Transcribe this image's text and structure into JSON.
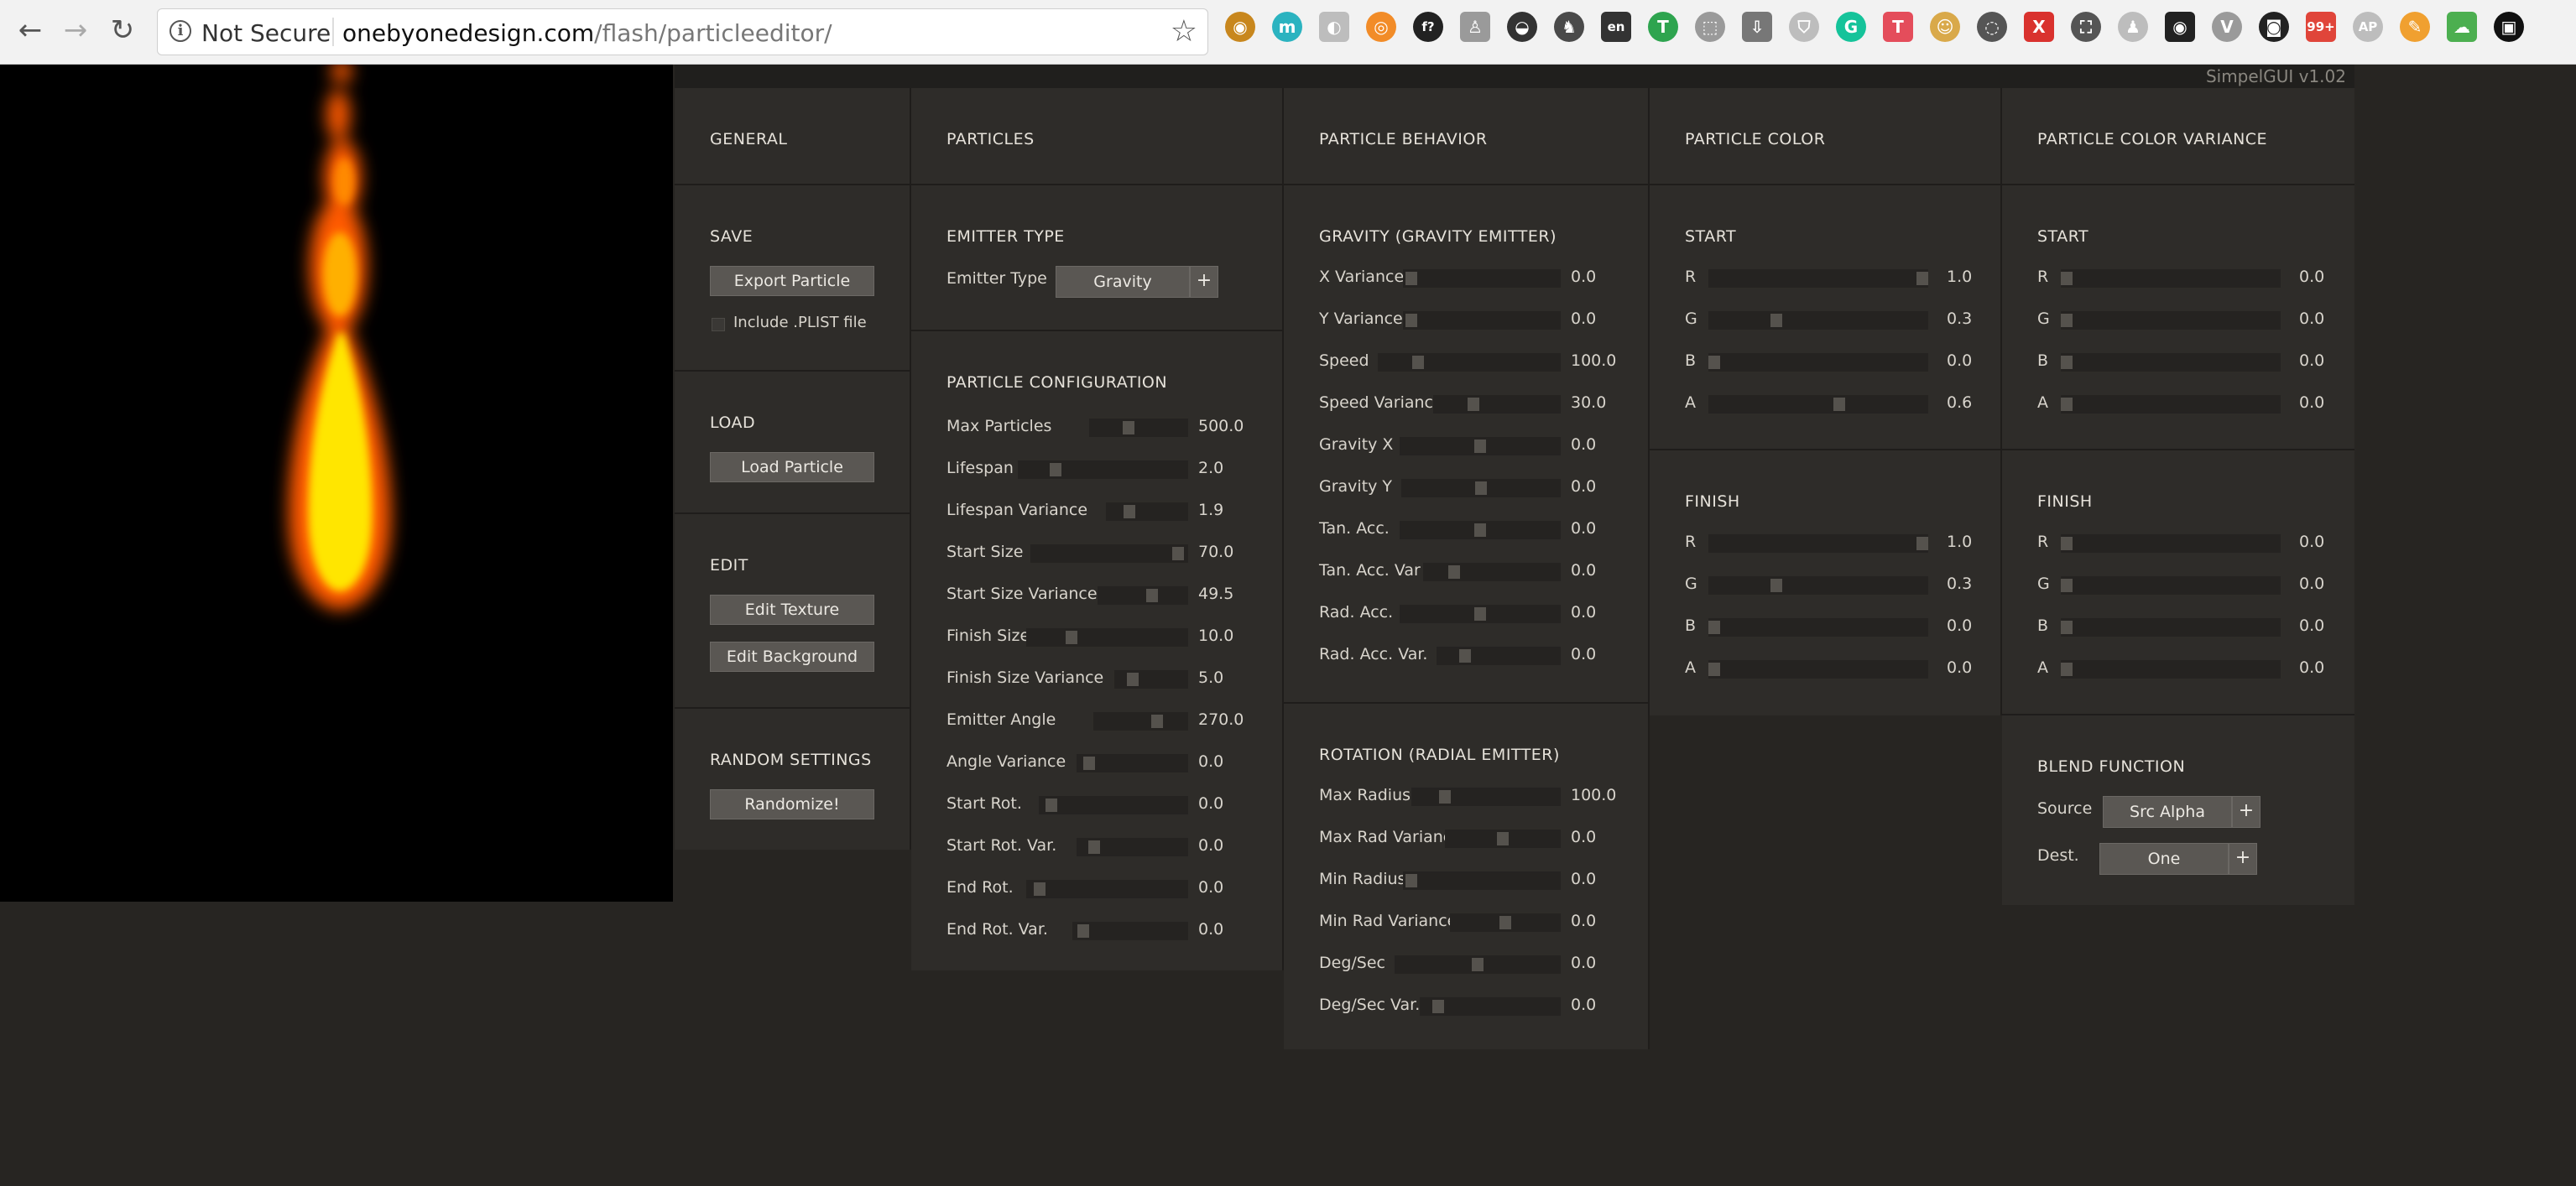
{
  "browser": {
    "back_icon": "arrow-left-icon",
    "forward_icon": "arrow-right-icon",
    "reload_icon": "reload-icon",
    "security_label": "Not Secure",
    "url_domain": "onebyonedesign.com",
    "url_path": "/flash/particleeditor/",
    "star_icon": "star-icon",
    "extensions": [
      {
        "name": "camera-ext-icon",
        "glyph": "◉",
        "color": "#c8871e"
      },
      {
        "name": "m-ext-icon",
        "glyph": "m",
        "color": "#2bb3c0"
      },
      {
        "name": "feather-ext-icon",
        "glyph": "◐",
        "color": "#bdbdbd"
      },
      {
        "name": "target-ext-icon",
        "glyph": "◎",
        "color": "#f28c28"
      },
      {
        "name": "fx-ext-icon",
        "glyph": "f?",
        "color": "#222222"
      },
      {
        "name": "person-ext-icon",
        "glyph": "♙",
        "color": "#9a9a9a"
      },
      {
        "name": "mask-ext-icon",
        "glyph": "◒",
        "color": "#333333"
      },
      {
        "name": "elephant-ext-icon",
        "glyph": "♞",
        "color": "#4a4a4a"
      },
      {
        "name": "en-ext-icon",
        "glyph": "en",
        "color": "#333333"
      },
      {
        "name": "shield-t-ext-icon",
        "glyph": "T",
        "color": "#2ea44f"
      },
      {
        "name": "puzzle-ext-icon",
        "glyph": "⬚",
        "color": "#9a9a9a"
      },
      {
        "name": "download-ext-icon",
        "glyph": "⇩",
        "color": "#777777"
      },
      {
        "name": "shield-ext-icon",
        "glyph": "⛉",
        "color": "#bdbdbd"
      },
      {
        "name": "grammarly-ext-icon",
        "glyph": "G",
        "color": "#15c39a"
      },
      {
        "name": "t-red-ext-icon",
        "glyph": "T",
        "color": "#e44d5b"
      },
      {
        "name": "face-ext-icon",
        "glyph": "☺",
        "color": "#d9a94a"
      },
      {
        "name": "ring-ext-icon",
        "glyph": "◌",
        "color": "#555555"
      },
      {
        "name": "x-ext-icon",
        "glyph": "X",
        "color": "#d9322e"
      },
      {
        "name": "frame-ext-icon",
        "glyph": "⛶",
        "color": "#555555"
      },
      {
        "name": "user-ext-icon",
        "glyph": "♟",
        "color": "#bdbdbd"
      },
      {
        "name": "eye-ext-icon",
        "glyph": "◉",
        "color": "#222222"
      },
      {
        "name": "v-ext-icon",
        "glyph": "V",
        "color": "#9a9a9a"
      },
      {
        "name": "glasses-ext-icon",
        "glyph": "◙",
        "color": "#222222"
      },
      {
        "name": "gift-ext-icon",
        "glyph": "99+",
        "color": "#e0453a"
      },
      {
        "name": "ap-ext-icon",
        "glyph": "AP",
        "color": "#bdbdbd"
      },
      {
        "name": "pencil-ext-icon",
        "glyph": "✎",
        "color": "#f0a030"
      },
      {
        "name": "cloud-ext-icon",
        "glyph": "☁",
        "color": "#4caf50"
      },
      {
        "name": "square-ext-icon",
        "glyph": "▣",
        "color": "#111111"
      }
    ]
  },
  "header": {
    "version": "SimpelGUI v1.02"
  },
  "general": {
    "heading": "GENERAL",
    "save_title": "SAVE",
    "export_button": "Export Particle",
    "include_plist": "Include .PLIST file",
    "include_plist_checked": false,
    "load_title": "LOAD",
    "load_button": "Load Particle",
    "edit_title": "EDIT",
    "edit_texture_button": "Edit Texture",
    "edit_background_button": "Edit Background",
    "random_title": "RANDOM SETTINGS",
    "randomize_button": "Randomize!"
  },
  "particles": {
    "heading": "PARTICLES",
    "emitter_type_title": "EMITTER TYPE",
    "emitter_type_label": "Emitter Type",
    "emitter_type_value": "Gravity",
    "emitter_type_toggle": "+",
    "config_title": "PARTICLE CONFIGURATION",
    "sliders": [
      {
        "label": "Max Particles",
        "value": "500.0",
        "level": 0.38
      },
      {
        "label": "Lifespan",
        "value": "2.0",
        "level": 0.2
      },
      {
        "label": "Lifespan Variance",
        "value": "1.9",
        "level": 0.25
      },
      {
        "label": "Start Size",
        "value": "70.0",
        "level": 0.97
      },
      {
        "label": "Start Size Variance",
        "value": "49.5",
        "level": 0.62
      },
      {
        "label": "Finish Size",
        "value": "10.0",
        "level": 0.26
      },
      {
        "label": "Finish Size Variance",
        "value": "5.0",
        "level": 0.2
      },
      {
        "label": "Emitter Angle",
        "value": "270.0",
        "level": 0.7
      },
      {
        "label": "Angle Variance",
        "value": "0.0",
        "level": 0.07
      },
      {
        "label": "Start Rot.",
        "value": "0.0",
        "level": 0.05
      },
      {
        "label": "Start Rot. Var.",
        "value": "0.0",
        "level": 0.12
      },
      {
        "label": "End Rot.",
        "value": "0.0",
        "level": 0.05
      },
      {
        "label": "End Rot. Var.",
        "value": "0.0",
        "level": 0.05
      }
    ]
  },
  "behavior": {
    "heading": "PARTICLE BEHAVIOR",
    "gravity_title": "GRAVITY (GRAVITY EMITTER)",
    "gravity_sliders": [
      {
        "label": "X Variance",
        "value": "0.0",
        "level": 0.02
      },
      {
        "label": "Y Variance",
        "value": "0.0",
        "level": 0.02
      },
      {
        "label": "Speed",
        "value": "100.0",
        "level": 0.2
      },
      {
        "label": "Speed Variance",
        "value": "30.0",
        "level": 0.3
      },
      {
        "label": "Gravity X",
        "value": "0.0",
        "level": 0.5
      },
      {
        "label": "Gravity Y",
        "value": "0.0",
        "level": 0.5
      },
      {
        "label": "Tan. Acc.",
        "value": "0.0",
        "level": 0.5
      },
      {
        "label": "Tan. Acc. Var",
        "value": "0.0",
        "level": 0.2
      },
      {
        "label": "Rad. Acc.",
        "value": "0.0",
        "level": 0.5
      },
      {
        "label": "Rad. Acc. Var.",
        "value": "0.0",
        "level": 0.2
      }
    ],
    "rotation_title": "ROTATION (RADIAL EMITTER)",
    "rotation_sliders": [
      {
        "label": "Max Radius",
        "value": "100.0",
        "level": 0.2
      },
      {
        "label": "Max Rad Variance",
        "value": "0.0",
        "level": 0.5
      },
      {
        "label": "Min Radius",
        "value": "0.0",
        "level": 0.02
      },
      {
        "label": "Min Rad Variance",
        "value": "0.0",
        "level": 0.5
      },
      {
        "label": "Deg/Sec",
        "value": "0.0",
        "level": 0.5
      },
      {
        "label": "Deg/Sec Var.",
        "value": "0.0",
        "level": 0.1
      }
    ]
  },
  "color": {
    "heading": "PARTICLE COLOR",
    "start_title": "START",
    "start": [
      {
        "label": "R",
        "value": "1.0",
        "level": 1.0
      },
      {
        "label": "G",
        "value": "0.3",
        "level": 0.3
      },
      {
        "label": "B",
        "value": "0.0",
        "level": 0.0
      },
      {
        "label": "A",
        "value": "0.6",
        "level": 0.6
      }
    ],
    "finish_title": "FINISH",
    "finish": [
      {
        "label": "R",
        "value": "1.0",
        "level": 1.0
      },
      {
        "label": "G",
        "value": "0.3",
        "level": 0.3
      },
      {
        "label": "B",
        "value": "0.0",
        "level": 0.0
      },
      {
        "label": "A",
        "value": "0.0",
        "level": 0.0
      }
    ]
  },
  "variance": {
    "heading": "PARTICLE COLOR VARIANCE",
    "start_title": "START",
    "start": [
      {
        "label": "R",
        "value": "0.0",
        "level": 0.0
      },
      {
        "label": "G",
        "value": "0.0",
        "level": 0.0
      },
      {
        "label": "B",
        "value": "0.0",
        "level": 0.0
      },
      {
        "label": "A",
        "value": "0.0",
        "level": 0.0
      }
    ],
    "finish_title": "FINISH",
    "finish": [
      {
        "label": "R",
        "value": "0.0",
        "level": 0.0
      },
      {
        "label": "G",
        "value": "0.0",
        "level": 0.0
      },
      {
        "label": "B",
        "value": "0.0",
        "level": 0.0
      },
      {
        "label": "A",
        "value": "0.0",
        "level": 0.0
      }
    ]
  },
  "blend": {
    "title": "BLEND FUNCTION",
    "source_label": "Source",
    "source_value": "Src Alpha",
    "dest_label": "Dest.",
    "dest_value": "One",
    "toggle": "+"
  },
  "colors": {
    "flame_core": "#ffe600",
    "flame_outer": "#ff5a00",
    "panel": "#2e2c29",
    "background": "#272522"
  }
}
